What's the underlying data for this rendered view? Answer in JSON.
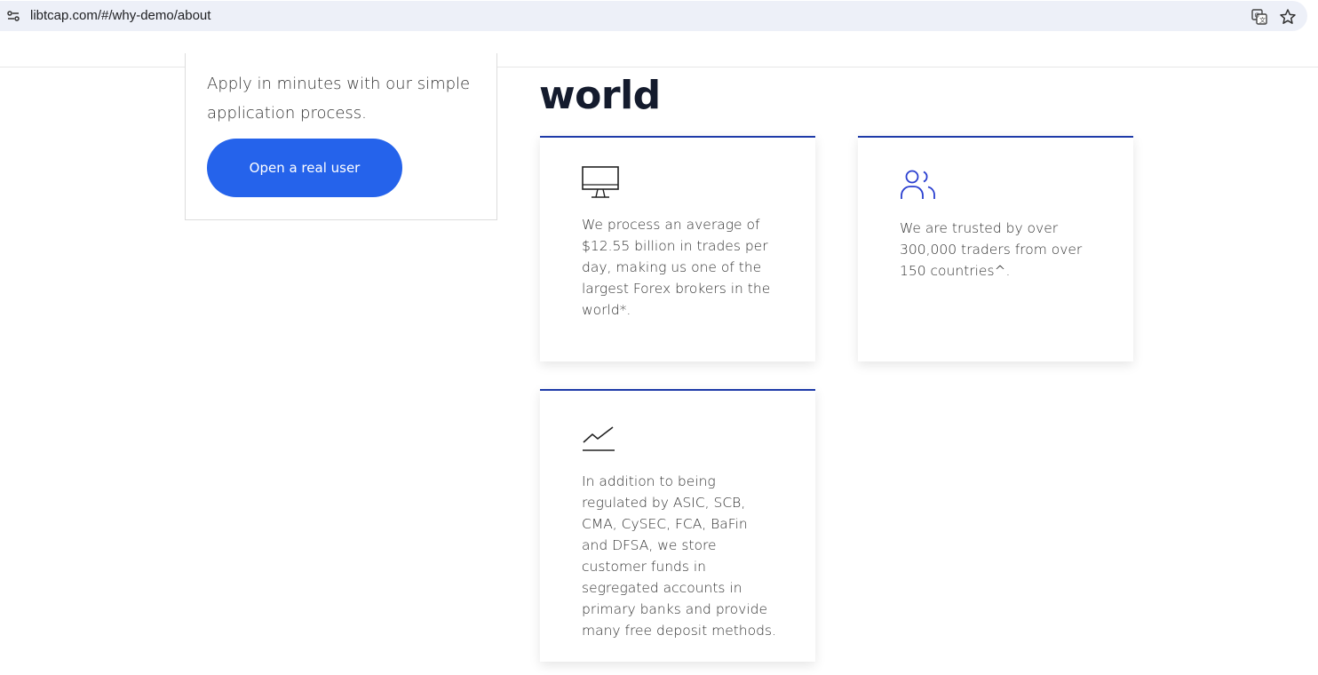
{
  "browser": {
    "url": "libtcap.com/#/why-demo/about"
  },
  "apply": {
    "text": "Apply in minutes with our simple application process.",
    "button_label": "Open a real user"
  },
  "section": {
    "heading": "world"
  },
  "cards": [
    {
      "icon": "monitor-icon",
      "text": "We process an average of $12.55 billion in trades per day, making us one of the largest Forex brokers in the world*."
    },
    {
      "icon": "users-icon",
      "text": "We are trusted by over 300,000 traders from over 150 countries^."
    },
    {
      "icon": "chart-line-icon",
      "text": "In addition to being regulated by ASIC, SCB, CMA, CySEC, FCA, BaFin and DFSA, we store customer funds in segregated accounts in primary banks and provide many free deposit methods."
    }
  ],
  "colors": {
    "accent": "#2563eb",
    "card_border": "#1d3aa8",
    "heading": "#141b2d"
  }
}
